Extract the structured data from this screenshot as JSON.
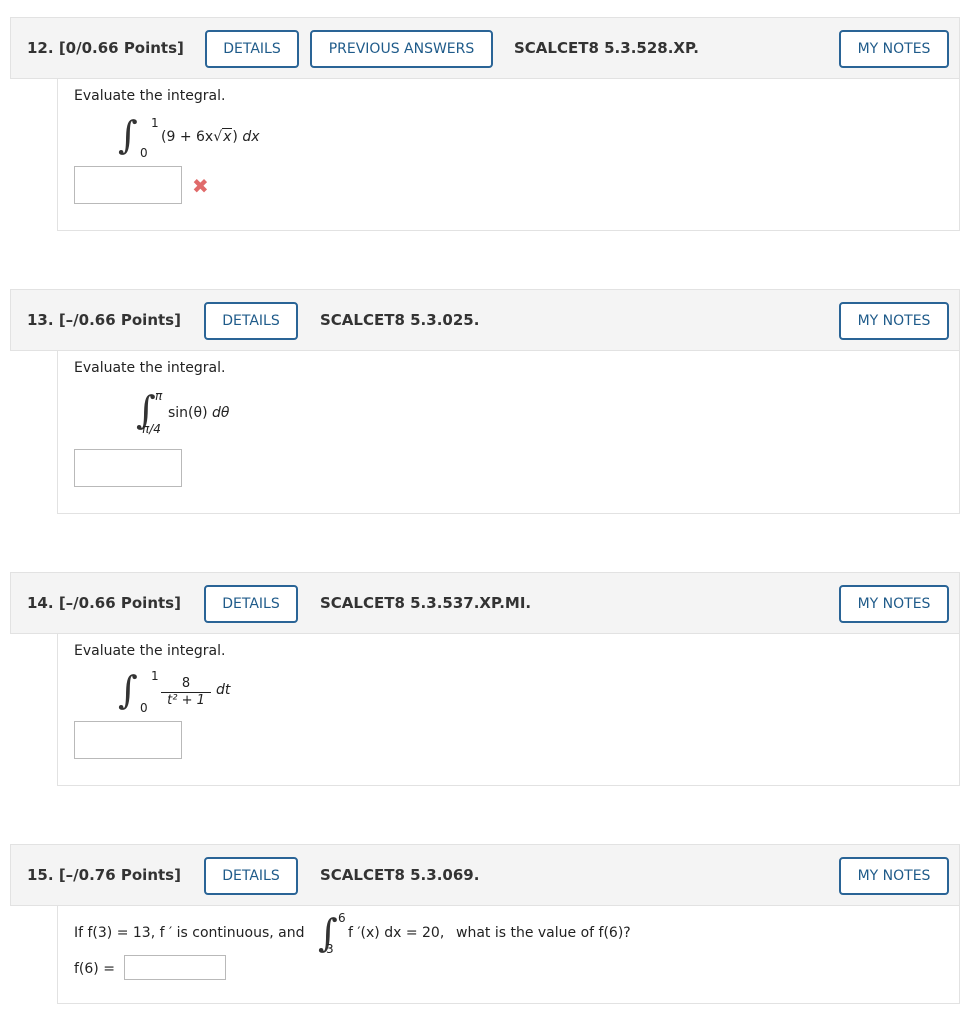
{
  "questions": [
    {
      "number": "12.",
      "points": "[0/0.66 Points]",
      "details_label": "DETAILS",
      "previous_answers_label": "PREVIOUS ANSWERS",
      "code": "SCALCET8 5.3.528.XP.",
      "notes_label": "MY NOTES",
      "prompt": "Evaluate the integral.",
      "upper": "1",
      "lower": "0",
      "expr_pre": "(9 + 6x",
      "expr_rad": "x",
      "expr_post": ")",
      "dvar": "dx",
      "status": "incorrect"
    },
    {
      "number": "13.",
      "points": "[–/0.66 Points]",
      "details_label": "DETAILS",
      "code": "SCALCET8 5.3.025.",
      "notes_label": "MY NOTES",
      "prompt": "Evaluate the integral.",
      "upper": "π",
      "lower": "π/4",
      "expr": "sin(θ)",
      "dvar": "dθ"
    },
    {
      "number": "14.",
      "points": "[–/0.66 Points]",
      "details_label": "DETAILS",
      "code": "SCALCET8 5.3.537.XP.MI.",
      "notes_label": "MY NOTES",
      "prompt": "Evaluate the integral.",
      "upper": "1",
      "lower": "0",
      "numerator": "8",
      "denominator": "t² + 1",
      "dvar": "dt"
    },
    {
      "number": "15.",
      "points": "[–/0.76 Points]",
      "details_label": "DETAILS",
      "code": "SCALCET8 5.3.069.",
      "notes_label": "MY NOTES",
      "text_before": "If f(3) = 13, f ′ is continuous, and",
      "upper": "6",
      "lower": "3",
      "integrand": "f ′(x) dx = 20,",
      "text_after": "what is the value of f(6)?",
      "answer_label": "f(6) ="
    }
  ]
}
